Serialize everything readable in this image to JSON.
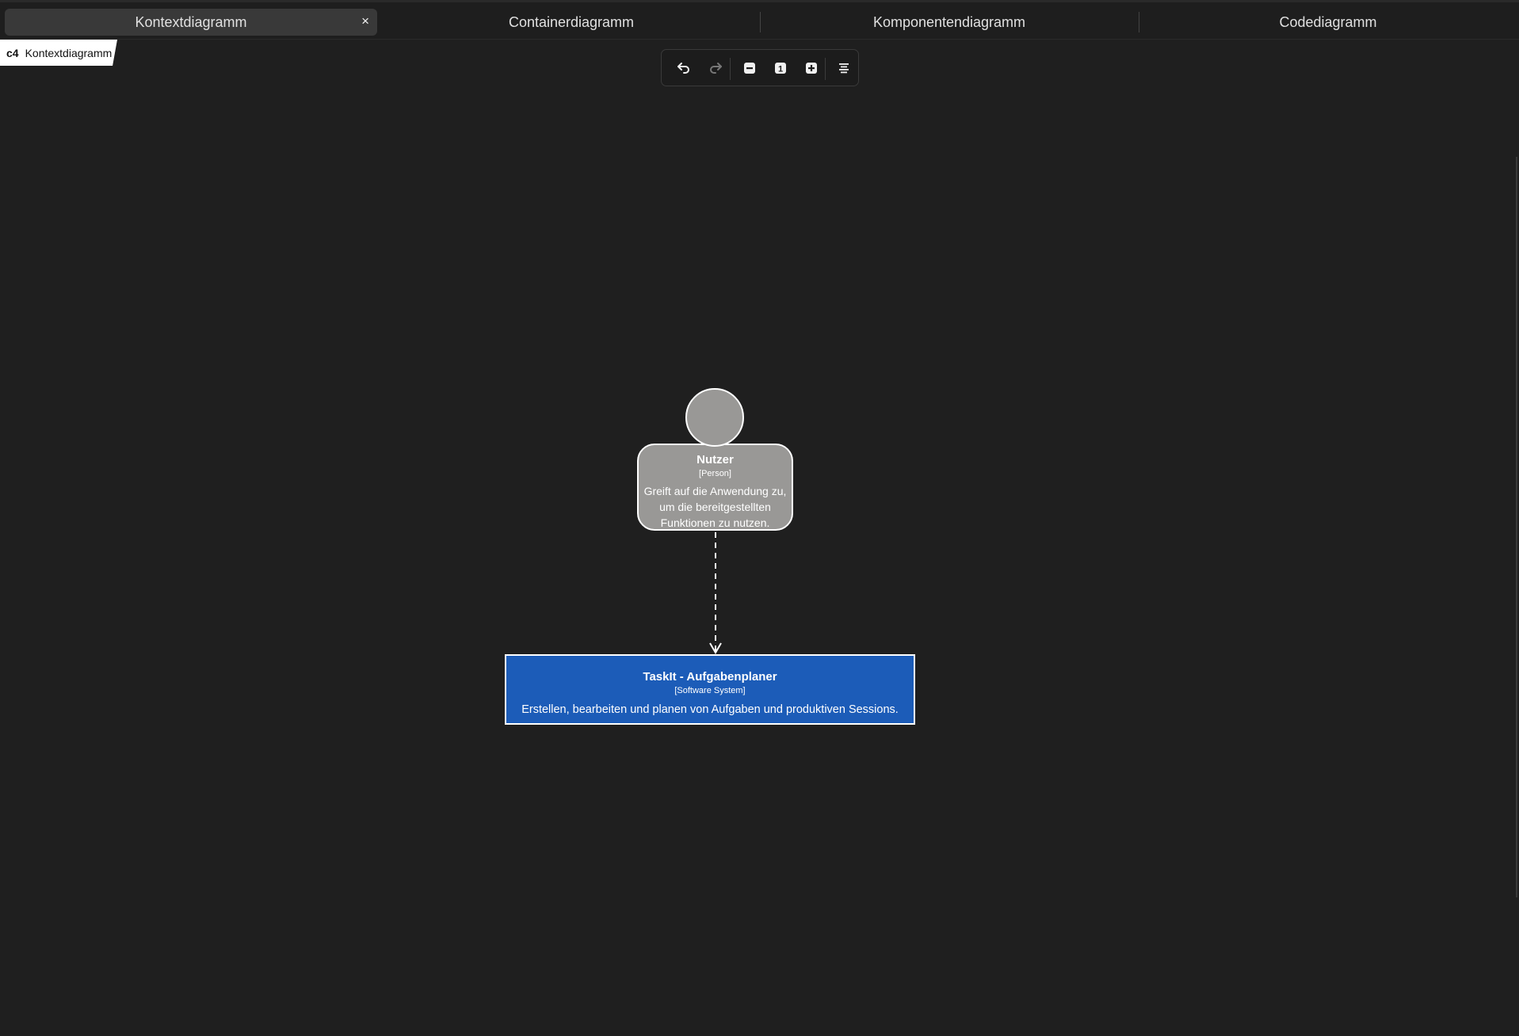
{
  "tabs": [
    {
      "label": "Kontextdiagramm",
      "active": true
    },
    {
      "label": "Containerdiagramm",
      "active": false
    },
    {
      "label": "Komponentendiagramm",
      "active": false
    },
    {
      "label": "Codediagramm",
      "active": false
    }
  ],
  "close_symbol": "×",
  "badge": {
    "prefix": "c4",
    "label": "Kontextdiagramm"
  },
  "toolbar": {
    "buttons": [
      "undo-icon",
      "redo-icon",
      "zoom-out-icon",
      "zoom-reset-icon",
      "zoom-in-icon",
      "layout-menu-icon"
    ],
    "zoom_reset_label": "1"
  },
  "diagram": {
    "person": {
      "name": "Nutzer",
      "type": "[Person]",
      "description": "Greift auf die Anwendung zu, um die bereitgestellten Funktionen zu nutzen.",
      "fill": "#999896"
    },
    "system": {
      "name": "TaskIt - Aufgabenplaner",
      "type": "[Software System]",
      "description": "Erstellen, bearbeiten und planen von Aufgaben und produktiven Sessions.",
      "fill": "#1c5cb8"
    },
    "relation": {
      "style": "dashed",
      "from": "Nutzer",
      "to": "TaskIt - Aufgabenplaner"
    }
  }
}
